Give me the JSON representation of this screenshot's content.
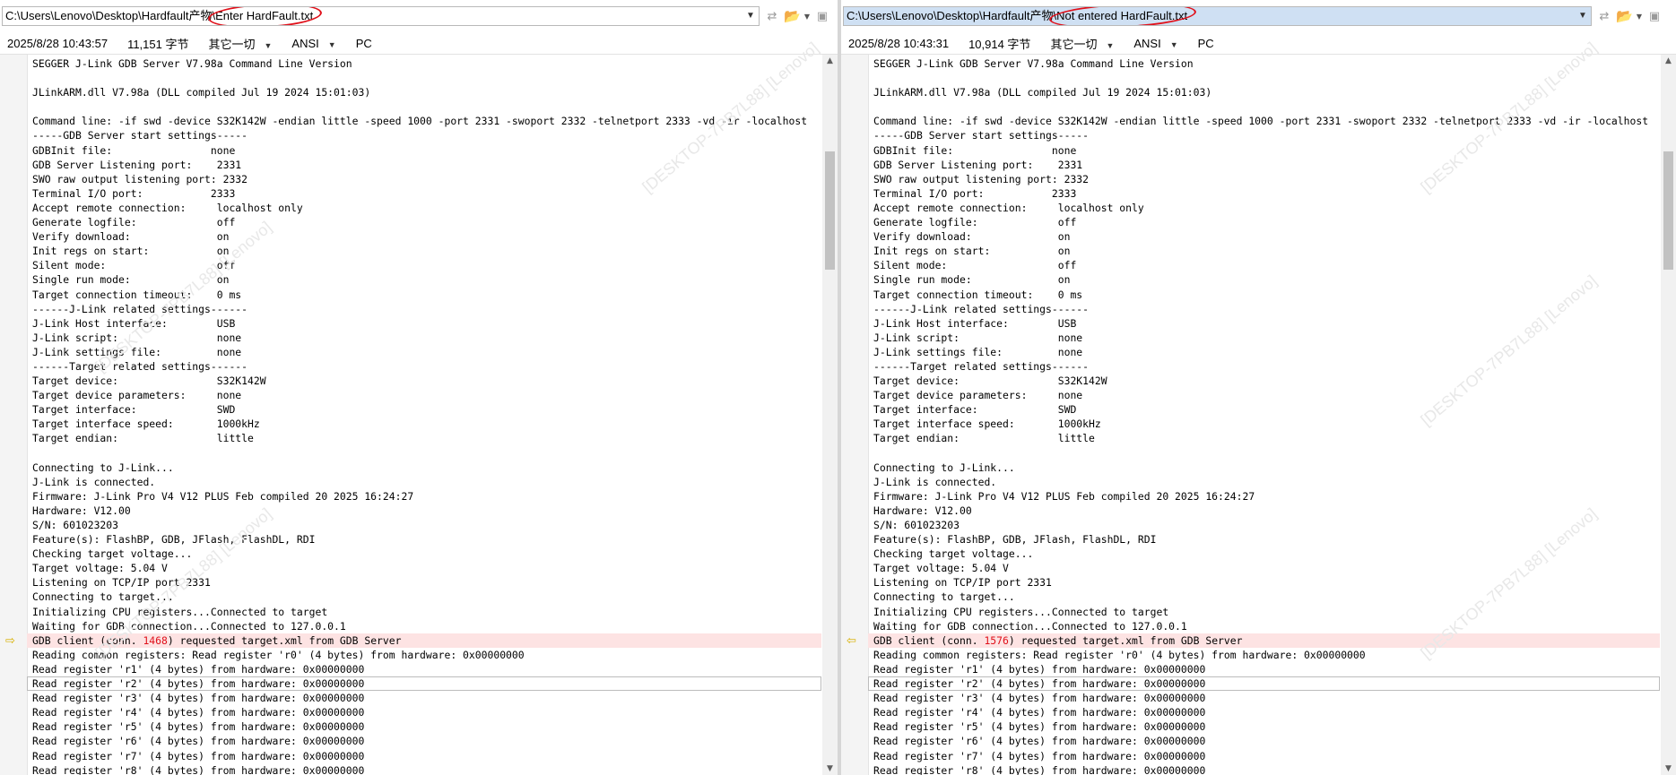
{
  "left": {
    "path_dir": "C:\\Users\\Lenovo\\Desktop\\Hardfault产物\\",
    "path_file": "Enter HardFault.txt",
    "date": "2025/8/28 10:43:57",
    "size": "11,151 字节",
    "filter": "其它一切",
    "encoding": "ANSI",
    "eol": "PC",
    "client_prefix": "GDB client (conn. ",
    "client_conn": "1468",
    "client_suffix": ") requested target.xml from GDB Server"
  },
  "right": {
    "path_dir": "C:\\Users\\Lenovo\\Desktop\\Hardfault产物\\",
    "path_file": "Not entered HardFault.txt",
    "date": "2025/8/28 10:43:31",
    "size": "10,914 字节",
    "filter": "其它一切",
    "encoding": "ANSI",
    "eol": "PC",
    "client_prefix": "GDB client (conn. ",
    "client_conn": "1576",
    "client_suffix": ") requested target.xml from GDB Server"
  },
  "lines": [
    "SEGGER J-Link GDB Server V7.98a Command Line Version",
    "",
    "JLinkARM.dll V7.98a (DLL compiled Jul 19 2024 15:01:03)",
    "",
    "Command line: -if swd -device S32K142W -endian little -speed 1000 -port 2331 -swoport 2332 -telnetport 2333 -vd -ir -localhost",
    "-----GDB Server start settings-----",
    "GDBInit file:                none",
    "GDB Server Listening port:    2331",
    "SWO raw output listening port: 2332",
    "Terminal I/O port:           2333",
    "Accept remote connection:     localhost only",
    "Generate logfile:             off",
    "Verify download:              on",
    "Init regs on start:           on",
    "Silent mode:                  off",
    "Single run mode:              on",
    "Target connection timeout:    0 ms",
    "------J-Link related settings------",
    "J-Link Host interface:        USB",
    "J-Link script:                none",
    "J-Link settings file:         none",
    "------Target related settings------",
    "Target device:                S32K142W",
    "Target device parameters:     none",
    "Target interface:             SWD",
    "Target interface speed:       1000kHz",
    "Target endian:                little",
    "",
    "Connecting to J-Link...",
    "J-Link is connected.",
    "Firmware: J-Link Pro V4 V12 PLUS Feb compiled 20 2025 16:24:27",
    "Hardware: V12.00",
    "S/N: 601023203",
    "Feature(s): FlashBP, GDB, JFlash, FlashDL, RDI",
    "Checking target voltage...",
    "Target voltage: 5.04 V",
    "Listening on TCP/IP port 2331",
    "Connecting to target...",
    "Initializing CPU registers...Connected to target",
    "Waiting for GDB connection...Connected to 127.0.0.1",
    "__CLIENT__",
    "Reading common registers: Read register 'r0' (4 bytes) from hardware: 0x00000000",
    "Read register 'r1' (4 bytes) from hardware: 0x00000000",
    "Read register 'r2' (4 bytes) from hardware: 0x00000000",
    "Read register 'r3' (4 bytes) from hardware: 0x00000000",
    "Read register 'r4' (4 bytes) from hardware: 0x00000000",
    "Read register 'r5' (4 bytes) from hardware: 0x00000000",
    "Read register 'r6' (4 bytes) from hardware: 0x00000000",
    "Read register 'r7' (4 bytes) from hardware: 0x00000000",
    "Read register 'r8' (4 bytes) from hardware: 0x00000000"
  ],
  "watermark": "[DESKTOP-7PB7L88] [Lenovo]",
  "icons": {
    "dropdown": "chevron-down-icon",
    "swap": "swap-icon",
    "open": "folder-open-icon",
    "save": "save-icon",
    "diff_left": "diff-arrow-right-icon",
    "diff_right": "diff-arrow-left-icon"
  },
  "colors": {
    "diff_bg": "#fde3e3",
    "annotation": "#e0101a",
    "arrow": "#d8b000"
  }
}
